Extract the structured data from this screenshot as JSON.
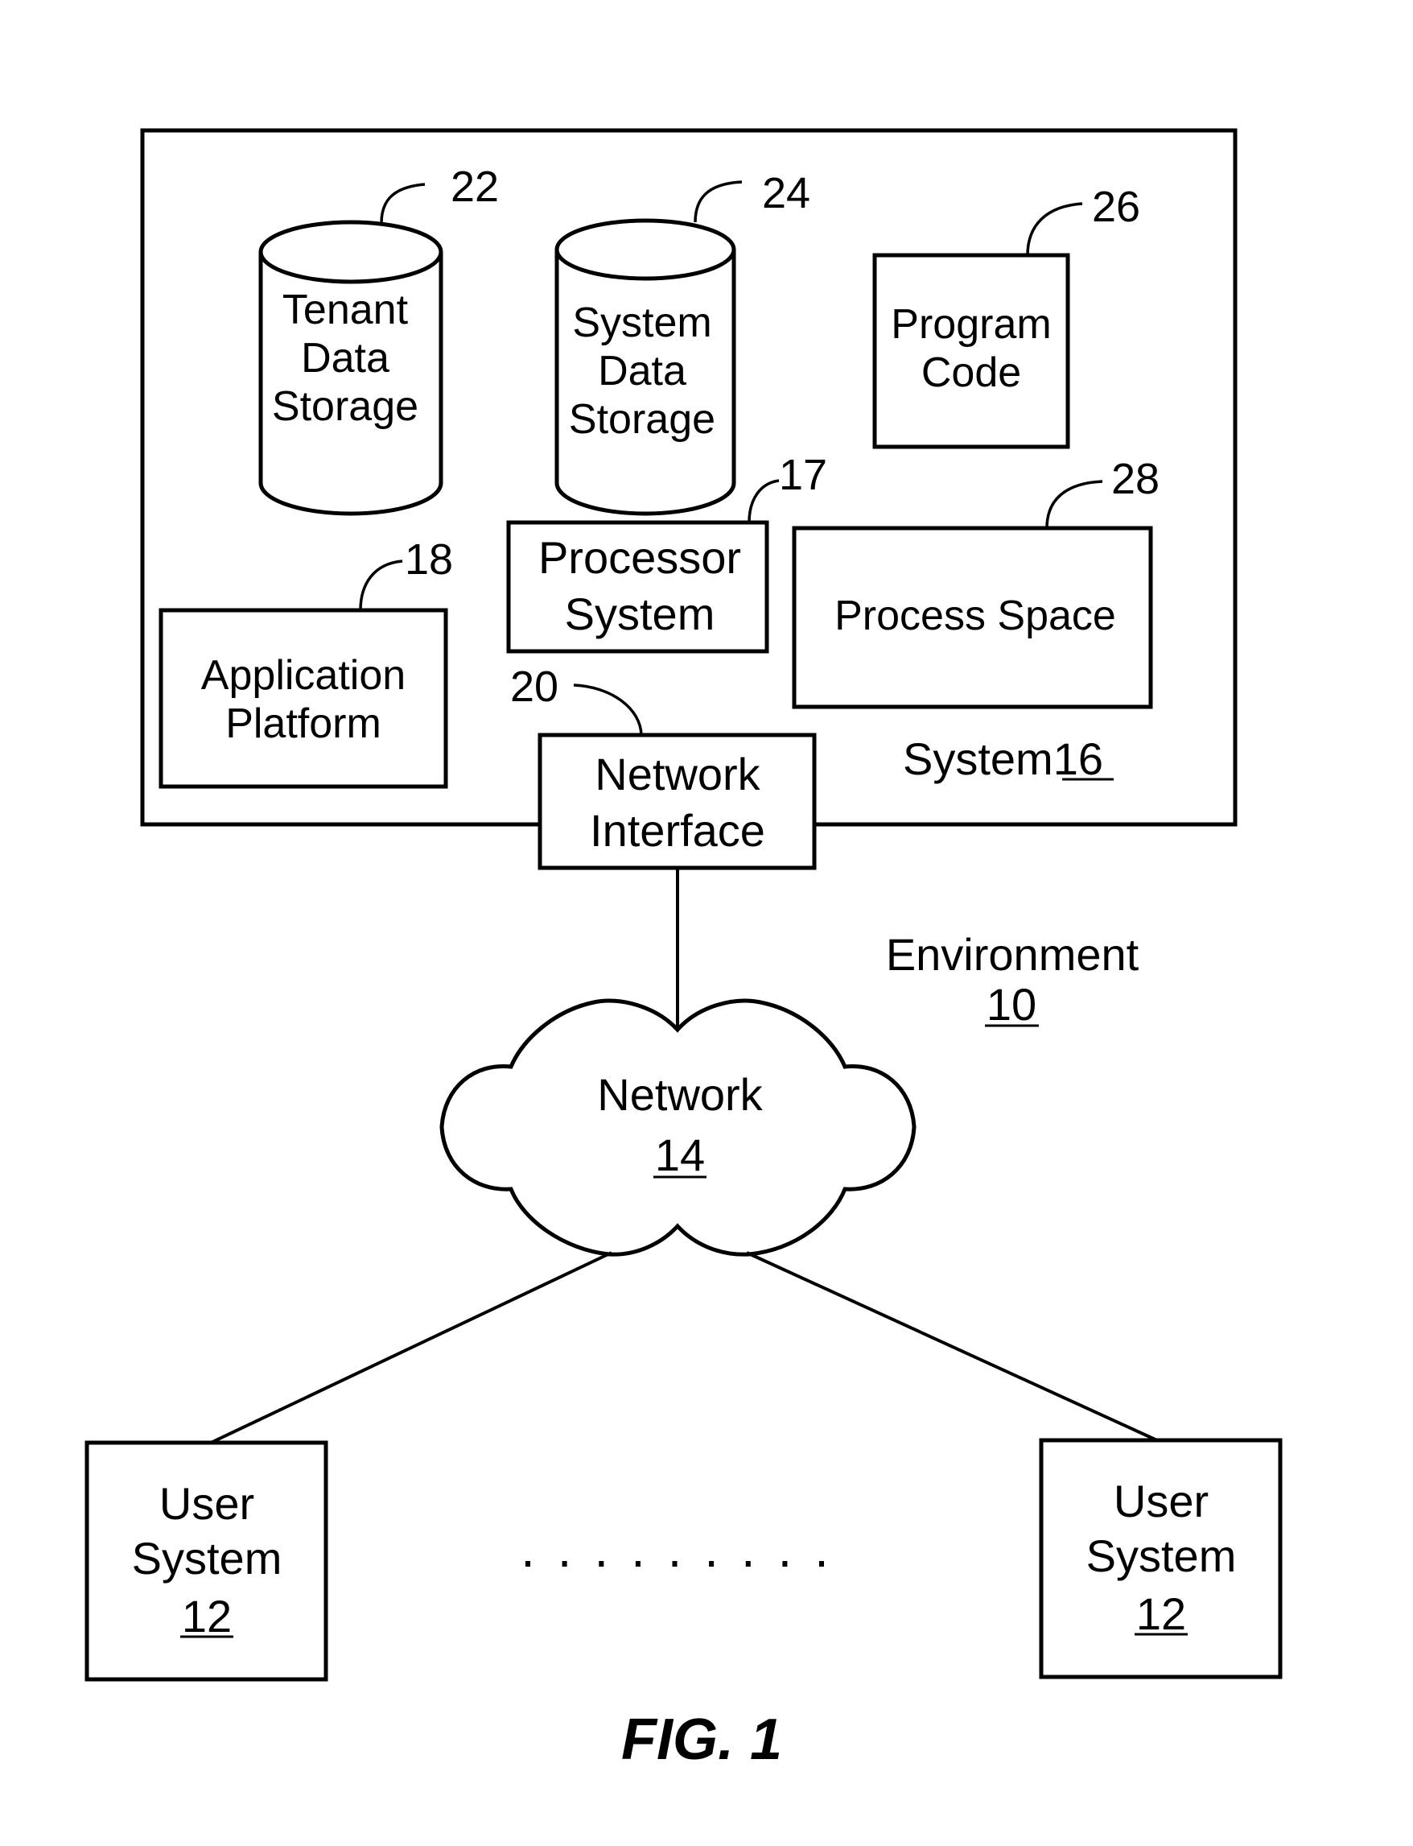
{
  "figure": {
    "caption": "FIG. 1"
  },
  "system": {
    "name": "System",
    "ref": "16",
    "components": {
      "tenant_storage": {
        "lines": [
          "Tenant",
          "Data",
          "Storage"
        ],
        "ref": "22"
      },
      "system_storage": {
        "lines": [
          "System",
          "Data",
          "Storage"
        ],
        "ref": "24"
      },
      "program_code": {
        "lines": [
          "Program",
          "Code"
        ],
        "ref": "26"
      },
      "processor_system": {
        "lines": [
          "Processor",
          "System"
        ],
        "ref": "17"
      },
      "process_space": {
        "lines": [
          "Process Space"
        ],
        "ref": "28"
      },
      "application_platform": {
        "lines": [
          "Application",
          "Platform"
        ],
        "ref": "18"
      },
      "network_interface": {
        "lines": [
          "Network",
          "Interface"
        ],
        "ref": "20"
      }
    }
  },
  "environment": {
    "name": "Environment",
    "ref": "10"
  },
  "network": {
    "name": "Network",
    "ref": "14"
  },
  "user_systems": [
    {
      "lines": [
        "User",
        "System"
      ],
      "ref": "12"
    },
    {
      "lines": [
        "User",
        "System"
      ],
      "ref": "12"
    }
  ],
  "ellipsis": {
    "dot_count": 9
  }
}
